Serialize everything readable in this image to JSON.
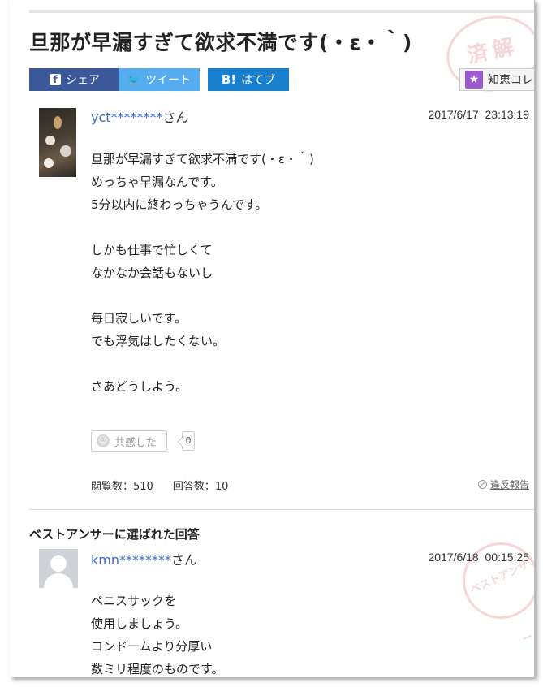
{
  "page": {
    "title": "旦那が早漏すぎて欲求不満です(・ε・｀)",
    "stamp_solved": "済解",
    "stamp_best": "ベストアンサー"
  },
  "share": {
    "facebook": {
      "icon": "facebook-icon",
      "label": "シェア",
      "color": "#3b5998"
    },
    "twitter": {
      "icon": "twitter-bird-icon",
      "label": "ツイート",
      "color": "#55acee"
    },
    "hatena": {
      "icon": "hatena-bookmark-icon",
      "icon_text": "B!",
      "label": "はてブ",
      "color": "#1a7fcc"
    },
    "chiebukuro": {
      "icon": "star-icon",
      "label": "知恵コレ"
    }
  },
  "question": {
    "user": "yct********",
    "honorific": "さん",
    "date": "2017/6/17  23:13:19",
    "body": [
      "旦那が早漏すぎて欲求不満です(・ε・｀)",
      "めっちゃ早漏なんです。",
      "5分以内に終わっちゃうんです。",
      "",
      "しかも仕事で忙しくて",
      "なかなか会話もないし",
      "",
      "毎日寂しいです。",
      "でも浮気はしたくない。",
      "",
      "さあどうしよう。"
    ],
    "empathy_label": "共感した",
    "empathy_count": "0",
    "views": "閲覧数：510",
    "answers": "回答数：10",
    "report": "違反報告"
  },
  "best_answer": {
    "heading": "ベストアンサーに選ばれた回答",
    "user": "kmn********",
    "honorific": "さん",
    "date": "2017/6/18  00:15:25",
    "body": [
      "ペニスサックを",
      "使用しましょう。",
      "コンドームより分厚い",
      "数ミリ程度のものです。"
    ]
  }
}
